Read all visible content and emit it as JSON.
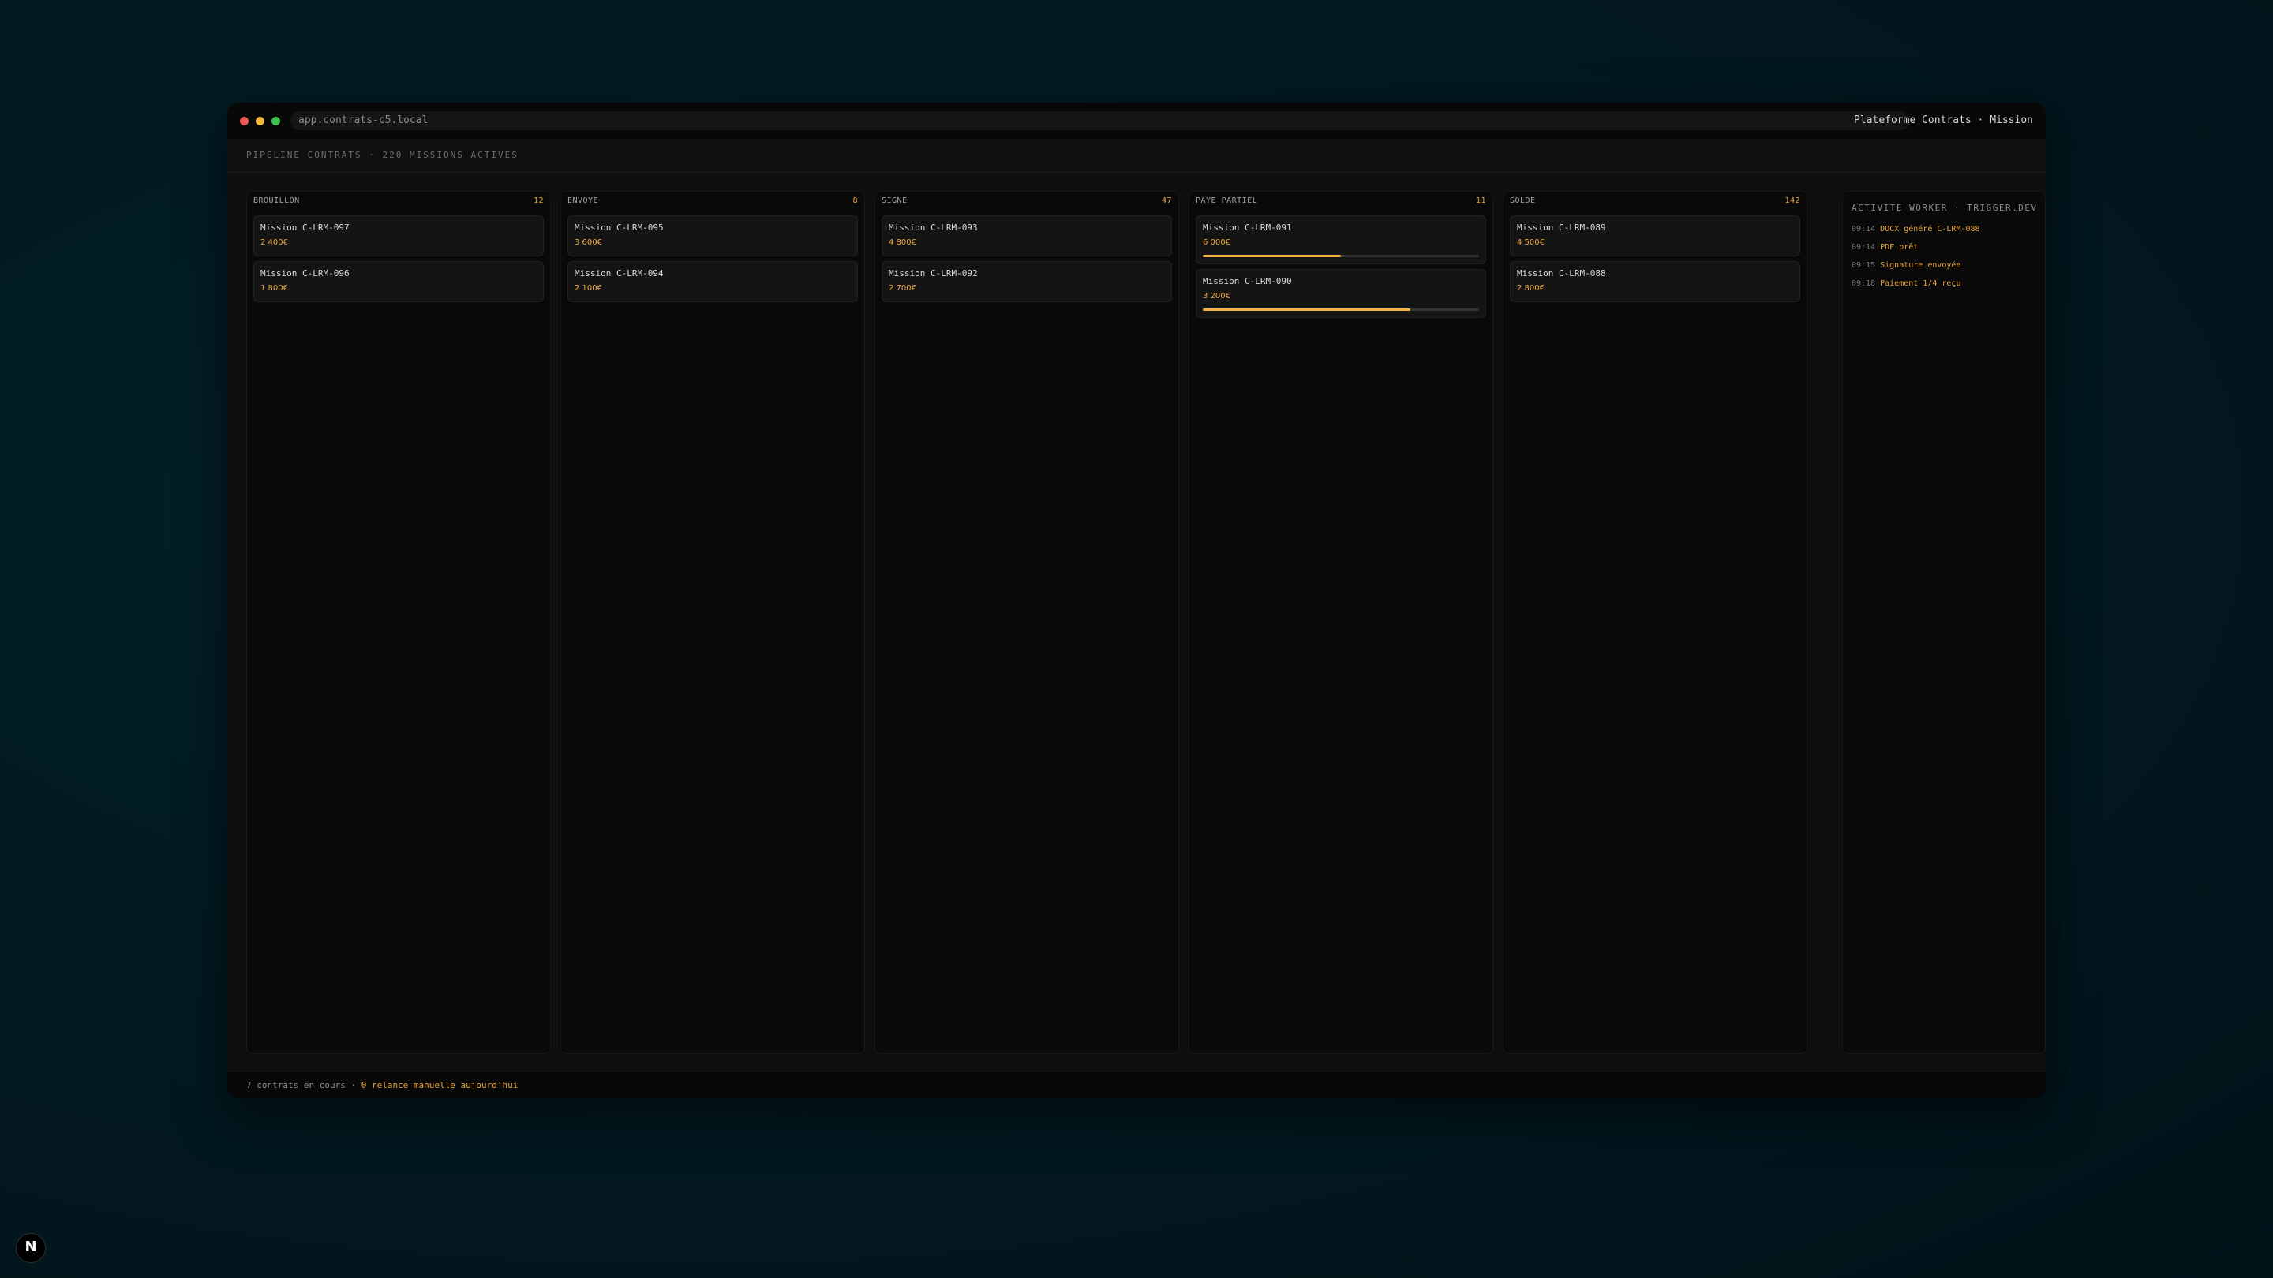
{
  "browser": {
    "url": "app.contrats-c5.local",
    "window_title": "Plateforme Contrats · Mission"
  },
  "header": {
    "title": "PIPELINE CONTRATS · 220 MISSIONS ACTIVES"
  },
  "columns": [
    {
      "name": "BROUILLON",
      "count": "12",
      "cards": [
        {
          "title": "Mission C-LRM-097",
          "amount": "2 400€"
        },
        {
          "title": "Mission C-LRM-096",
          "amount": "1 800€"
        }
      ]
    },
    {
      "name": "ENVOYE",
      "count": "8",
      "cards": [
        {
          "title": "Mission C-LRM-095",
          "amount": "3 600€"
        },
        {
          "title": "Mission C-LRM-094",
          "amount": "2 100€"
        }
      ]
    },
    {
      "name": "SIGNE",
      "count": "47",
      "cards": [
        {
          "title": "Mission C-LRM-093",
          "amount": "4 800€"
        },
        {
          "title": "Mission C-LRM-092",
          "amount": "2 700€"
        }
      ]
    },
    {
      "name": "PAYE PARTIEL",
      "count": "11",
      "cards": [
        {
          "title": "Mission C-LRM-091",
          "amount": "6 000€",
          "progress": 0.5
        },
        {
          "title": "Mission C-LRM-090",
          "amount": "3 200€",
          "progress": 0.75
        }
      ]
    },
    {
      "name": "SOLDE",
      "count": "142",
      "cards": [
        {
          "title": "Mission C-LRM-089",
          "amount": "4 500€"
        },
        {
          "title": "Mission C-LRM-088",
          "amount": "2 800€"
        }
      ]
    }
  ],
  "activity": {
    "title": "ACTIVITE WORKER · TRIGGER.DEV",
    "items": [
      {
        "time": "09:14",
        "message": "DOCX généré C-LRM-088"
      },
      {
        "time": "09:14",
        "message": "PDF prêt"
      },
      {
        "time": "09:15",
        "message": "Signature envoyée"
      },
      {
        "time": "09:18",
        "message": "Paiement 1/4 reçu"
      }
    ]
  },
  "status": {
    "text": "7 contrats en cours · ",
    "highlight": "0 relance manuelle aujourd'hui"
  },
  "badge": {
    "label": "N"
  },
  "colors": {
    "accent": "#e8a33a",
    "progress_fill": "#f5b341",
    "background": "#0e0e0e"
  }
}
